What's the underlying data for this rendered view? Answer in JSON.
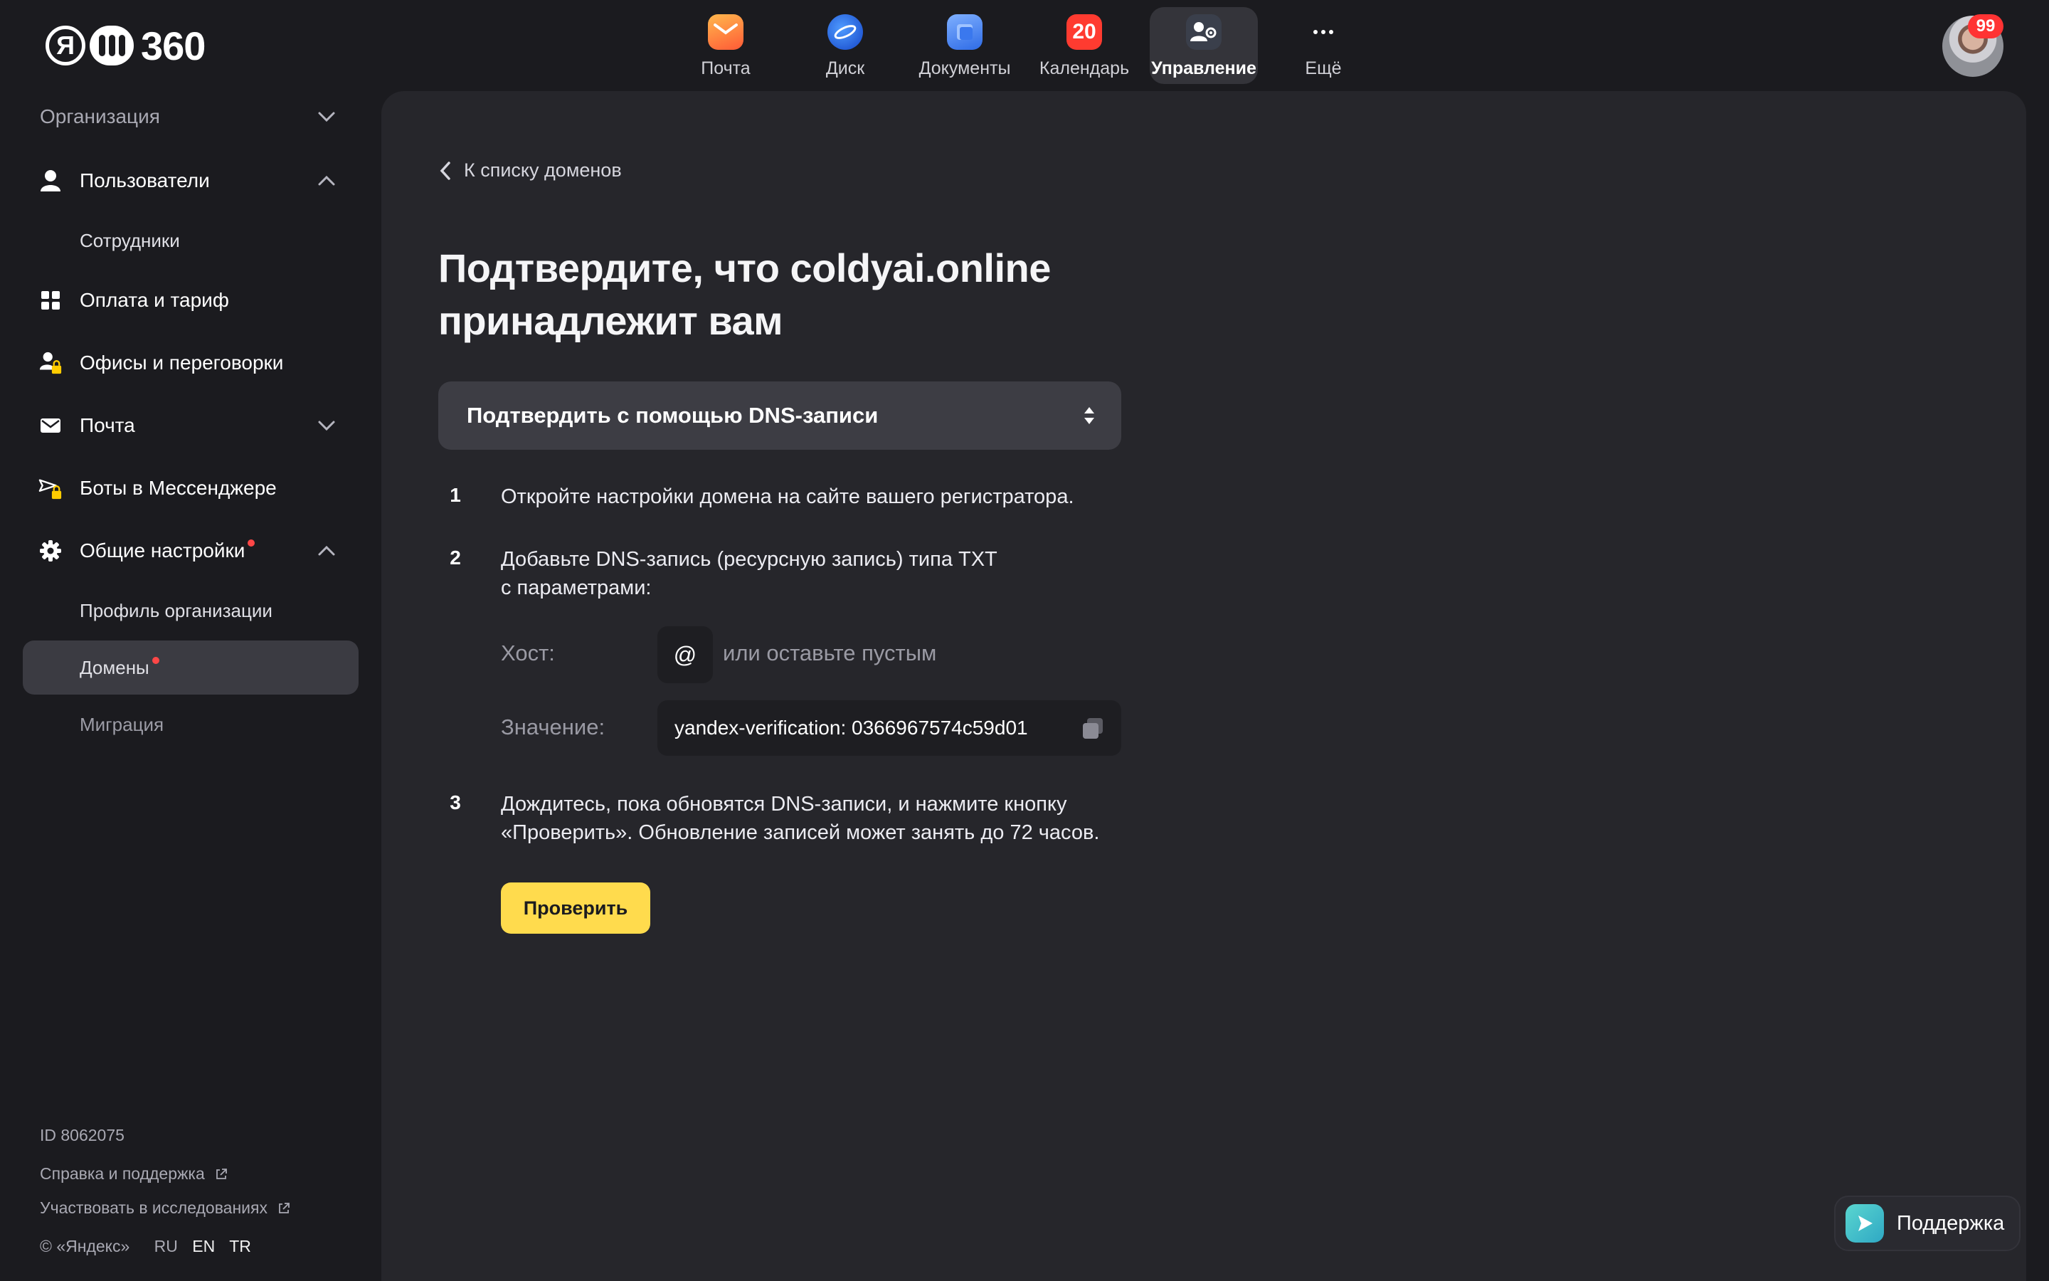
{
  "header": {
    "logo_text": "360",
    "logo_letter": "Я",
    "apps": [
      {
        "label": "Почта",
        "icon": "mail-icon",
        "color": "#ff9d2e"
      },
      {
        "label": "Диск",
        "icon": "disk-icon",
        "color": "#2a6ff0"
      },
      {
        "label": "Документы",
        "icon": "documents-icon",
        "color": "#4b8af7"
      },
      {
        "label": "Календарь",
        "icon": "calendar-icon",
        "color": "#ff3b30",
        "badge": "20"
      },
      {
        "label": "Управление",
        "icon": "admin-icon",
        "color": "#3a3f4b",
        "active": true
      },
      {
        "label": "Ещё",
        "icon": "more-icon"
      }
    ],
    "avatar_badge": "99"
  },
  "sidebar": {
    "org_label": "Организация",
    "items": [
      {
        "label": "Пользователи",
        "icon": "user-icon"
      },
      {
        "label": "Сотрудники"
      },
      {
        "label": "Оплата и тариф",
        "icon": "grid-icon"
      },
      {
        "label": "Офисы и переговорки",
        "icon": "office-lock-icon"
      },
      {
        "label": "Почта",
        "icon": "envelope-icon"
      },
      {
        "label": "Боты в Мессенджере",
        "icon": "bot-lock-icon"
      },
      {
        "label": "Общие настройки",
        "icon": "gear-icon"
      },
      {
        "label": "Профиль организации"
      },
      {
        "label": "Домены"
      },
      {
        "label": "Миграция"
      }
    ],
    "footer": {
      "org_id": "ID 8062075",
      "help_link": "Справка и поддержка",
      "research_link": "Участвовать в исследованиях",
      "copyright": "© «Яндекс»",
      "languages": [
        "RU",
        "EN",
        "TR"
      ]
    }
  },
  "main": {
    "back_link": "К списку доменов",
    "title_line1": "Подтвердите, что coldyai.online",
    "title_line2": "принадлежит вам",
    "method_select": "Подтвердить с помощью DNS-записи",
    "steps": [
      {
        "num": "1",
        "text": "Откройте настройки домена на сайте вашего регистратора."
      },
      {
        "num": "2",
        "text_line1": "Добавьте DNS-запись (ресурсную запись) типа TXT",
        "text_line2": "с параметрами:"
      },
      {
        "num": "3",
        "text_line1": "Дождитесь, пока обновятся DNS-записи, и нажмите кнопку",
        "text_line2": "«Проверить». Обновление записей может занять до 72 часов."
      }
    ],
    "host_label": "Хост:",
    "host_value": "@",
    "host_hint": "или оставьте пустым",
    "value_label": "Значение:",
    "value_text": "yandex-verification: 0366967574c59d01",
    "check_button": "Проверить"
  },
  "support_button": "Поддержка",
  "colors": {
    "accent": "#ffdb4d",
    "background": "#1b1b1f",
    "panel": "#26262b",
    "notify": "#ff4747"
  }
}
